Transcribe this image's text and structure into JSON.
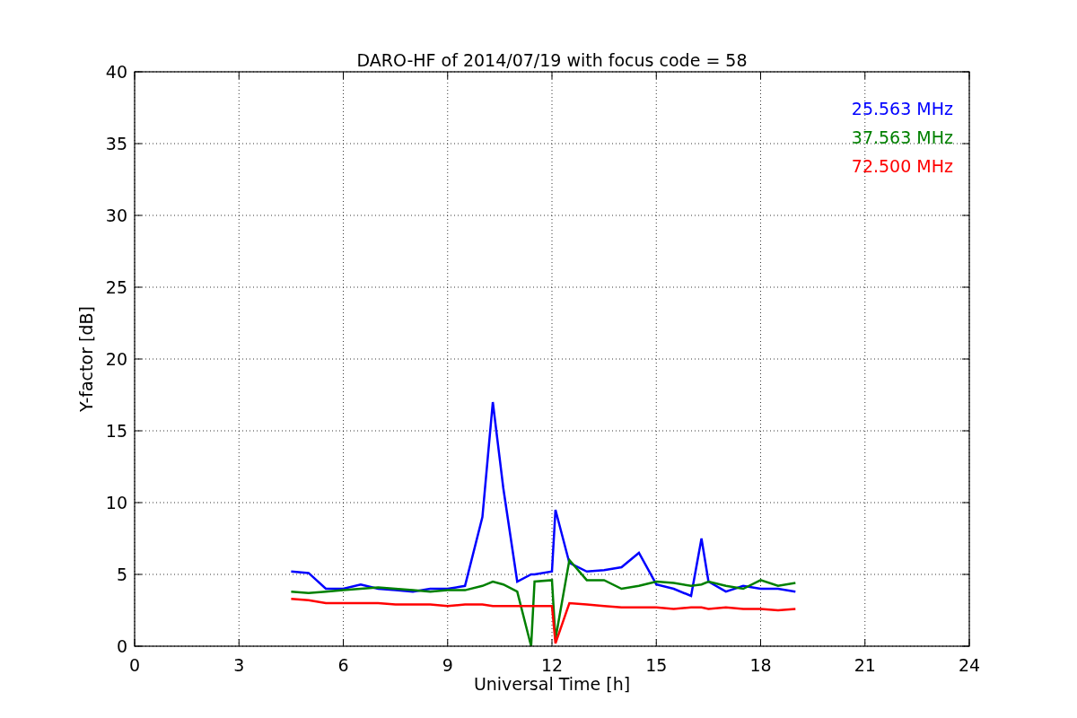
{
  "chart_data": {
    "type": "line",
    "title": "DARO-HF of 2014/07/19 with focus code = 58",
    "xlabel": "Universal Time [h]",
    "ylabel": "Y-factor [dB]",
    "x": [
      4.5,
      5,
      5.5,
      6,
      6.5,
      7,
      7.5,
      8,
      8.5,
      9,
      9.5,
      10,
      10.3,
      10.6,
      11,
      11.4,
      11.5,
      12,
      12.1,
      12.5,
      13,
      13.5,
      14,
      14.5,
      15,
      15.5,
      16,
      16.3,
      16.5,
      17,
      17.5,
      18,
      18.5,
      19
    ],
    "series": [
      {
        "name": "25.563 MHz",
        "color": "#0000ff",
        "values": [
          5.2,
          5.1,
          4.0,
          4.0,
          4.3,
          4.0,
          3.9,
          3.8,
          4.0,
          4.0,
          4.2,
          9,
          17,
          11,
          4.5,
          5.0,
          5.0,
          5.2,
          9.5,
          5.8,
          5.2,
          5.3,
          5.5,
          6.5,
          4.3,
          4.0,
          3.5,
          7.5,
          4.5,
          3.8,
          4.2,
          4.0,
          4.0,
          3.8
        ]
      },
      {
        "name": "37.563 MHz",
        "color": "#008000",
        "values": [
          3.8,
          3.7,
          3.8,
          3.9,
          4.0,
          4.1,
          4.0,
          3.9,
          3.8,
          3.9,
          3.9,
          4.2,
          4.5,
          4.3,
          3.8,
          0,
          4.5,
          4.6,
          0.5,
          6.0,
          4.6,
          4.6,
          4.0,
          4.2,
          4.5,
          4.4,
          4.2,
          4.3,
          4.5,
          4.2,
          4.0,
          4.6,
          4.2,
          4.4
        ]
      },
      {
        "name": "72.500 MHz",
        "color": "#ff0000",
        "values": [
          3.3,
          3.2,
          3.0,
          3.0,
          3.0,
          3.0,
          2.9,
          2.9,
          2.9,
          2.8,
          2.9,
          2.9,
          2.8,
          2.8,
          2.8,
          2.8,
          2.8,
          2.8,
          0.2,
          3.0,
          2.9,
          2.8,
          2.7,
          2.7,
          2.7,
          2.6,
          2.7,
          2.7,
          2.6,
          2.7,
          2.6,
          2.6,
          2.5,
          2.6
        ]
      }
    ],
    "grid": true,
    "xlim": [
      0,
      24
    ],
    "ylim": [
      0,
      40
    ],
    "xticks": [
      0,
      3,
      6,
      9,
      12,
      15,
      18,
      21,
      24
    ],
    "yticks": [
      0,
      5,
      10,
      15,
      20,
      25,
      30,
      35,
      40
    ]
  }
}
